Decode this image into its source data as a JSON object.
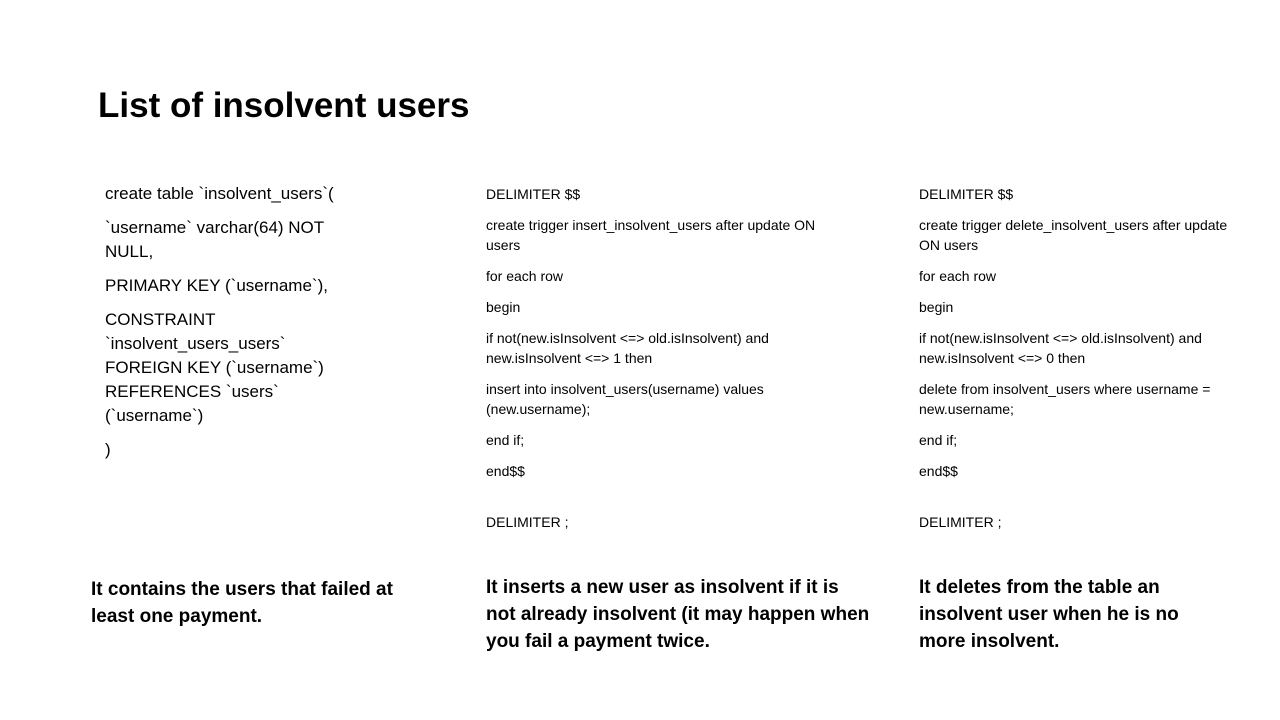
{
  "slide": {
    "title": "List of insolvent users"
  },
  "table_definition": {
    "lines": [
      "create table `insolvent_users`(",
      "`username` varchar(64) NOT NULL,",
      "PRIMARY KEY (`username`),",
      "CONSTRAINT `insolvent_users_users` FOREIGN KEY (`username`) REFERENCES `users` (`username`)",
      ")"
    ],
    "description": "It contains the users that failed at least one payment."
  },
  "insert_trigger": {
    "lines": [
      "DELIMITER $$",
      "create trigger insert_insolvent_users after update ON users",
      "for each row",
      "begin",
      "if not(new.isInsolvent <=> old.isInsolvent) and new.isInsolvent <=> 1 then",
      "insert into insolvent_users(username) values (new.username);",
      "end if;",
      "end$$",
      "DELIMITER ;"
    ],
    "description": "It inserts a new user as insolvent if it is not already insolvent (it may happen when you fail a payment twice."
  },
  "delete_trigger": {
    "lines": [
      "DELIMITER $$",
      "create trigger delete_insolvent_users after update ON users",
      "for each row",
      "begin",
      "if not(new.isInsolvent <=> old.isInsolvent) and new.isInsolvent <=> 0 then",
      "delete from insolvent_users where username = new.username;",
      "end if;",
      "end$$",
      "DELIMITER ;"
    ],
    "description": "It deletes from the table an insolvent user when he is no more insolvent."
  }
}
